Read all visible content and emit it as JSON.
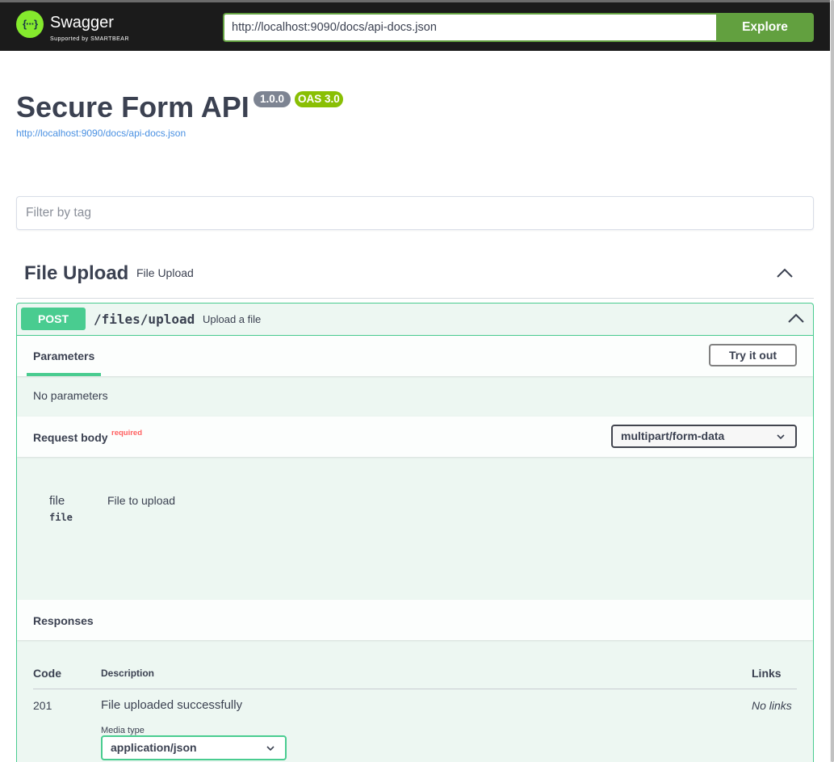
{
  "topbar": {
    "logo_name": "Swagger",
    "logo_sub": "Supported by SMARTBEAR",
    "url_value": "http://localhost:9090/docs/api-docs.json",
    "explore_label": "Explore"
  },
  "info": {
    "title": "Secure Form API",
    "version": "1.0.0",
    "oas": "OAS 3.0",
    "spec_url": "http://localhost:9090/docs/api-docs.json"
  },
  "filter": {
    "placeholder": "Filter by tag"
  },
  "tag": {
    "name": "File Upload",
    "description": "File Upload"
  },
  "operation": {
    "method": "POST",
    "path": "/files/upload",
    "summary": "Upload a file",
    "parameters_tab": "Parameters",
    "try_label": "Try it out",
    "no_params": "No parameters",
    "request_body_title": "Request body",
    "required_label": "required",
    "content_type": "multipart/form-data",
    "body_param": {
      "name": "file",
      "type": "file",
      "description": "File to upload"
    },
    "responses_title": "Responses",
    "columns": {
      "code": "Code",
      "description": "Description",
      "links": "Links"
    },
    "responses": [
      {
        "code": "201",
        "description": "File uploaded successfully",
        "links": "No links",
        "media_type_label": "Media type",
        "media_type": "application/json"
      }
    ]
  },
  "colors": {
    "post": "#49cc90",
    "topbar": "#1b1b1b",
    "accent": "#62a03f"
  }
}
